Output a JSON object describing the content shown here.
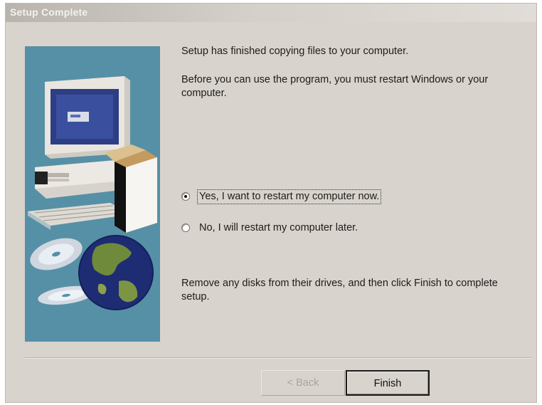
{
  "window": {
    "title": "Setup Complete"
  },
  "message": {
    "line1": "Setup has finished copying files to your computer.",
    "line2": "Before you can use the program, you must restart Windows or your computer."
  },
  "options": [
    {
      "label": "Yes, I want to restart my computer now.",
      "selected": true
    },
    {
      "label": "No, I will restart my computer later.",
      "selected": false
    }
  ],
  "footer_text": "Remove any disks from their drives, and then click Finish to complete setup.",
  "buttons": {
    "back": "< Back",
    "finish": "Finish"
  },
  "colors": {
    "art_background": "#5690a6",
    "dialog_background": "#d8d3cc"
  },
  "art": {
    "icons": [
      "computer-icon",
      "box-icon",
      "cd-icon",
      "globe-icon"
    ]
  }
}
